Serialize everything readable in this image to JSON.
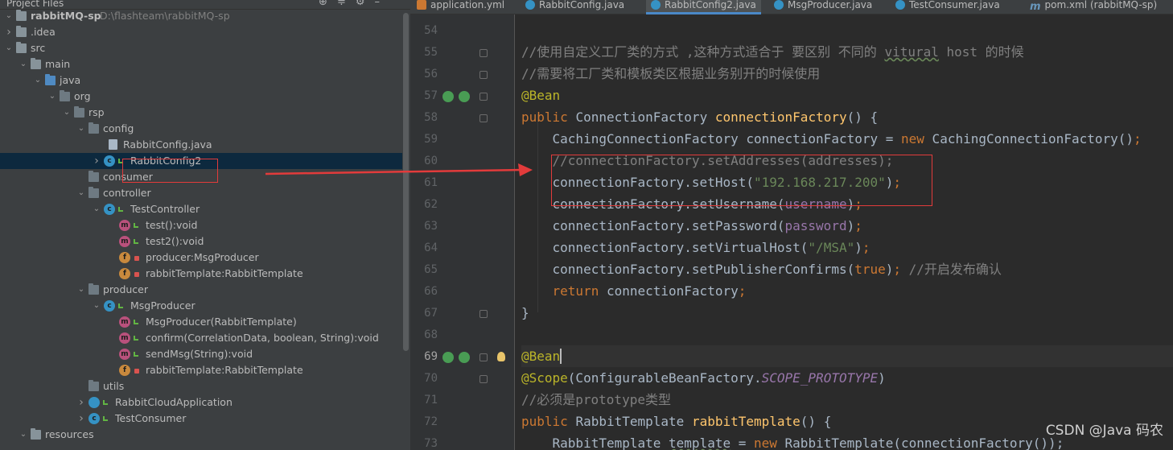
{
  "project": {
    "header_title": "Project Files",
    "tree": [
      {
        "label": "rabbitMQ-sp",
        "path": "D:\\flashteam\\rabbitMQ-sp",
        "type": "root"
      },
      {
        "label": ".idea",
        "type": "folder"
      },
      {
        "label": "src",
        "type": "folder"
      },
      {
        "label": "main",
        "type": "folder"
      },
      {
        "label": "java",
        "type": "src-folder"
      },
      {
        "label": "org",
        "type": "package"
      },
      {
        "label": "rsp",
        "type": "package"
      },
      {
        "label": "config",
        "type": "package"
      },
      {
        "label": "RabbitConfig.java",
        "type": "file"
      },
      {
        "label": "RabbitConfig2",
        "type": "class",
        "selected": true
      },
      {
        "label": "consumer",
        "type": "package"
      },
      {
        "label": "controller",
        "type": "package"
      },
      {
        "label": "TestController",
        "type": "class"
      },
      {
        "label": "test():void",
        "type": "method"
      },
      {
        "label": "test2():void",
        "type": "method"
      },
      {
        "label": "producer:MsgProducer",
        "type": "field"
      },
      {
        "label": "rabbitTemplate:RabbitTemplate",
        "type": "field"
      },
      {
        "label": "producer",
        "type": "package"
      },
      {
        "label": "MsgProducer",
        "type": "class"
      },
      {
        "label": "MsgProducer(RabbitTemplate)",
        "type": "method"
      },
      {
        "label": "confirm(CorrelationData, boolean, String):void",
        "type": "method"
      },
      {
        "label": "sendMsg(String):void",
        "type": "method"
      },
      {
        "label": "rabbitTemplate:RabbitTemplate",
        "type": "field"
      },
      {
        "label": "utils",
        "type": "package"
      },
      {
        "label": "RabbitCloudApplication",
        "type": "app"
      },
      {
        "label": "TestConsumer",
        "type": "class"
      },
      {
        "label": "resources",
        "type": "folder"
      }
    ]
  },
  "tabs": [
    {
      "label": "application.yml",
      "icon": "yml-file-icon"
    },
    {
      "label": "RabbitConfig.java",
      "icon": "class-icon"
    },
    {
      "label": "RabbitConfig2.java",
      "icon": "class-icon",
      "active": true
    },
    {
      "label": "MsgProducer.java",
      "icon": "class-icon"
    },
    {
      "label": "TestConsumer.java",
      "icon": "class-icon"
    },
    {
      "label": "pom.xml (rabbitMQ-sp)",
      "icon": "maven-icon"
    }
  ],
  "editor": {
    "line_numbers": [
      "54",
      "55",
      "56",
      "57",
      "58",
      "59",
      "60",
      "61",
      "62",
      "63",
      "64",
      "65",
      "66",
      "67",
      "68",
      "69",
      "70",
      "71",
      "72",
      "73"
    ],
    "current_line": "69",
    "comment_55": "//使用自定义工厂类的方式 ,这种方式适合于 要区别 不同的 ",
    "comment_55_ul": "vitural",
    "comment_55_end": " host 的时候",
    "comment_56": "//需要将工厂类和模板类区根据业务别开的时候使用",
    "annotation_bean": "@Bean",
    "kw_public": "public",
    "type_connection_factory": "ConnectionFactory",
    "method_connection_factory": "connectionFactory",
    "parens_brace": "() {",
    "line59_type": "CachingConnectionFactory",
    "line59_var": " connectionFactory = ",
    "kw_new": "new",
    "line59_ctor": " CachingConnectionFactory()",
    "semicolon": ";",
    "line60": "//connectionFactory.setAddresses(addresses);",
    "line61_call": "connectionFactory.setHost(",
    "line61_str": "\"192.168.217.200\"",
    "line61_end": ")",
    "line62_call": "connectionFactory.setUsername(",
    "line62_arg": "username",
    "line63_call": "connectionFactory.setPassword(",
    "line63_arg": "password",
    "line64_call": "connectionFactory.setVirtualHost(",
    "line64_str": "\"/MSA\"",
    "line65_call": "connectionFactory.setPublisherConfirms(",
    "line65_kw": "true",
    "line65_comment": " //开启发布确认",
    "line66_kw": "return",
    "line66_var": " connectionFactory",
    "close_brace": "}",
    "line70_anno": "@Scope",
    "line70_open": "(ConfigurableBeanFactory.",
    "line70_const": "SCOPE_PROTOTYPE",
    "line71_comment": "//必须是prototype类型",
    "line72_type": "RabbitTemplate",
    "line72_method": "rabbitTemplate",
    "line73_start": "RabbitTemplate ",
    "line73_var": "template",
    "line73_mid": " = ",
    "line73_end": " RabbitTemplate(connectionFactory());"
  },
  "watermark": "CSDN @Java 码农",
  "colors": {
    "keyword": "#cc7832",
    "annotation": "#bbb529",
    "method": "#ffc66d",
    "string": "#6a8759",
    "comment": "#808080",
    "field": "#9876aa",
    "highlight_box": "#e23b3b",
    "selection": "#0d293e"
  }
}
